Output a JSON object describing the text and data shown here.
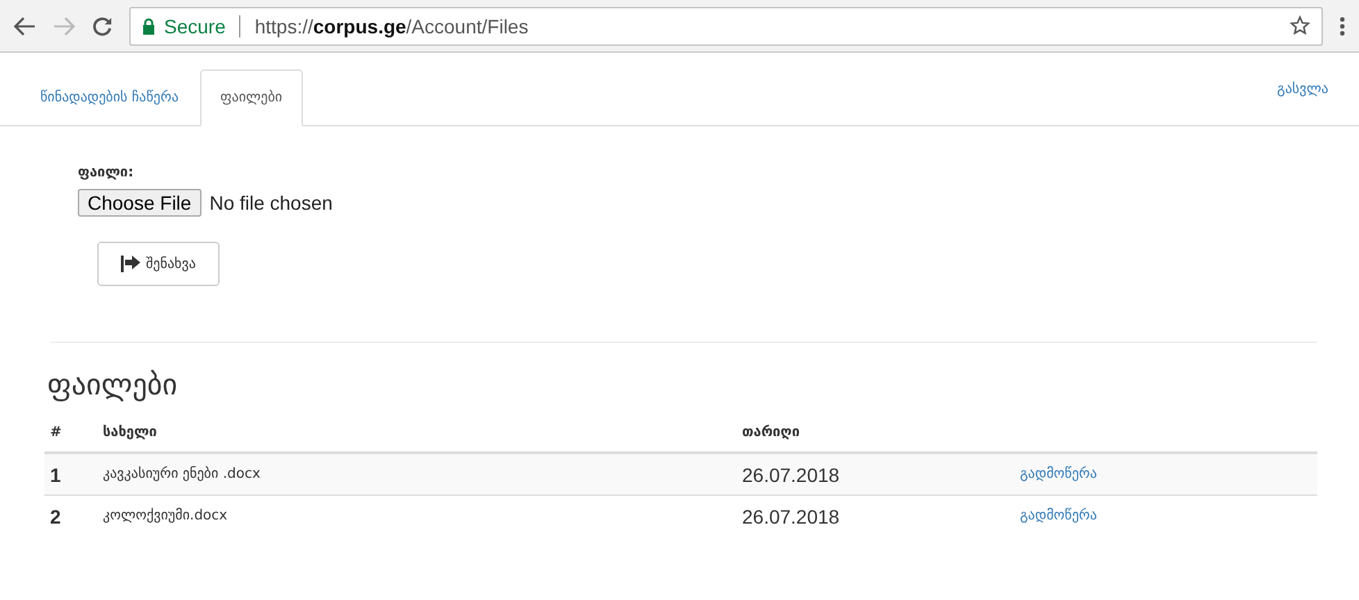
{
  "browser": {
    "security": "Secure",
    "url": "https://**corpus.ge**/Account/Files"
  },
  "tabs": [
    {
      "label": "წინადადების ჩაწერა",
      "selected": false
    },
    {
      "label": "ფაილები",
      "selected": true
    }
  ],
  "logout": "გასვლა",
  "form": {
    "label": "ფაილი:",
    "file_button": "Choose File",
    "file_status": "No file chosen",
    "save_button": "შენახვა"
  },
  "heading": "ფაილები",
  "table": {
    "columns": [
      "#",
      "სახელი",
      "თარიღი"
    ],
    "rows": [
      {
        "number": "1",
        "name": "კავკასიური ენები .docx",
        "date": "26.07.2018",
        "action": "გადმოწერა"
      },
      {
        "number": "2",
        "name": "კოლოქვიუმი.docx",
        "date": "26.07.2018",
        "action": "გადმოწერა"
      }
    ]
  }
}
